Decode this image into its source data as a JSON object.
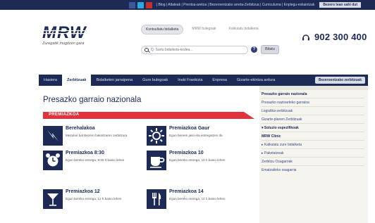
{
  "topbar": {
    "social": [
      "facebook-icon",
      "twitter-icon",
      "youtube-icon"
    ],
    "links": "| Blog | Altaleak | Prentsa-aretoa | Bezeroentzako arreta-Zerbitzua | Curriculuma | Enplegu-eskaintzak",
    "login_label": "Bezero lean sahi dut"
  },
  "header": {
    "logo_text": "MRW",
    "slogan": "Zuregatik mugitzen gara",
    "search_tabs": [
      "Kontsultatu bidalketa",
      "MRW bulegoak",
      "Kalkulatu bidalketa"
    ],
    "search_placeholder": "Q. Sartu bidalketa-kodea...",
    "search_button": "Bilatu",
    "phone": "902 300 400"
  },
  "nav": {
    "items": [
      {
        "label": "Hasiera",
        "active": false
      },
      {
        "label": "Zerbitzuak",
        "active": true
      },
      {
        "label": "Bidalketen jarraipena",
        "active": false
      },
      {
        "label": "Gure bulegoak",
        "active": false
      },
      {
        "label": "Inski Frankizia",
        "active": false
      },
      {
        "label": "Enpresa",
        "active": false
      },
      {
        "label": "Gizarte-ekintza ardura",
        "active": false
      }
    ],
    "login_label": "Bezeroentzako zerbitzuak"
  },
  "main": {
    "title": "Presazko garraio nazionala",
    "section_label": "PREMIAZKOA",
    "services": [
      {
        "title": "Berehalakoa",
        "desc": "Mezulari bat Bezero bakoitzaren zerbitzura",
        "icon": "lightning-icon"
      },
      {
        "title": "Premiazkoa Gaur",
        "desc": "Egun bereen jaso eta entregatzen da",
        "icon": "sun-icon"
      },
      {
        "title": "Premiazkoa 8:30",
        "desc": "Egun bereko entrega, 8:30 h baino lehen",
        "icon": "alarm-clock-icon"
      },
      {
        "title": "Premiazkoa 10",
        "desc": "Egun bereko entrega, 10 h baino lehen",
        "icon": "coffee-cup-icon"
      },
      {
        "title": "Premiazkoa 12",
        "desc": "Egun bereko entrega, 12 h baino lehen",
        "icon": "cocktail-glass-icon"
      },
      {
        "title": "Premiazkoa 14",
        "desc": "Egun bereko entrega, 14 h baino lehen",
        "icon": "cutlery-icon"
      }
    ]
  },
  "sidebar": {
    "items": [
      "Presazko garraio nazionala",
      "Presazko nazioarteko garraioa",
      "Logistika-zerbitzuak",
      "Gizarte-planen Zerbitzuak",
      "▾ Soluzio espezifikoak",
      "MRW Clinic",
      "▸ Kalkulatu zure bidalketa",
      "▸ Paketatzeak",
      "Zerbitzu Osagarriak",
      "Ematzaileko osagarria"
    ]
  },
  "colors": {
    "navy": "#1c2a55",
    "accent_red": "#e2323b",
    "sidebar_bg": "#f5f4ee"
  }
}
